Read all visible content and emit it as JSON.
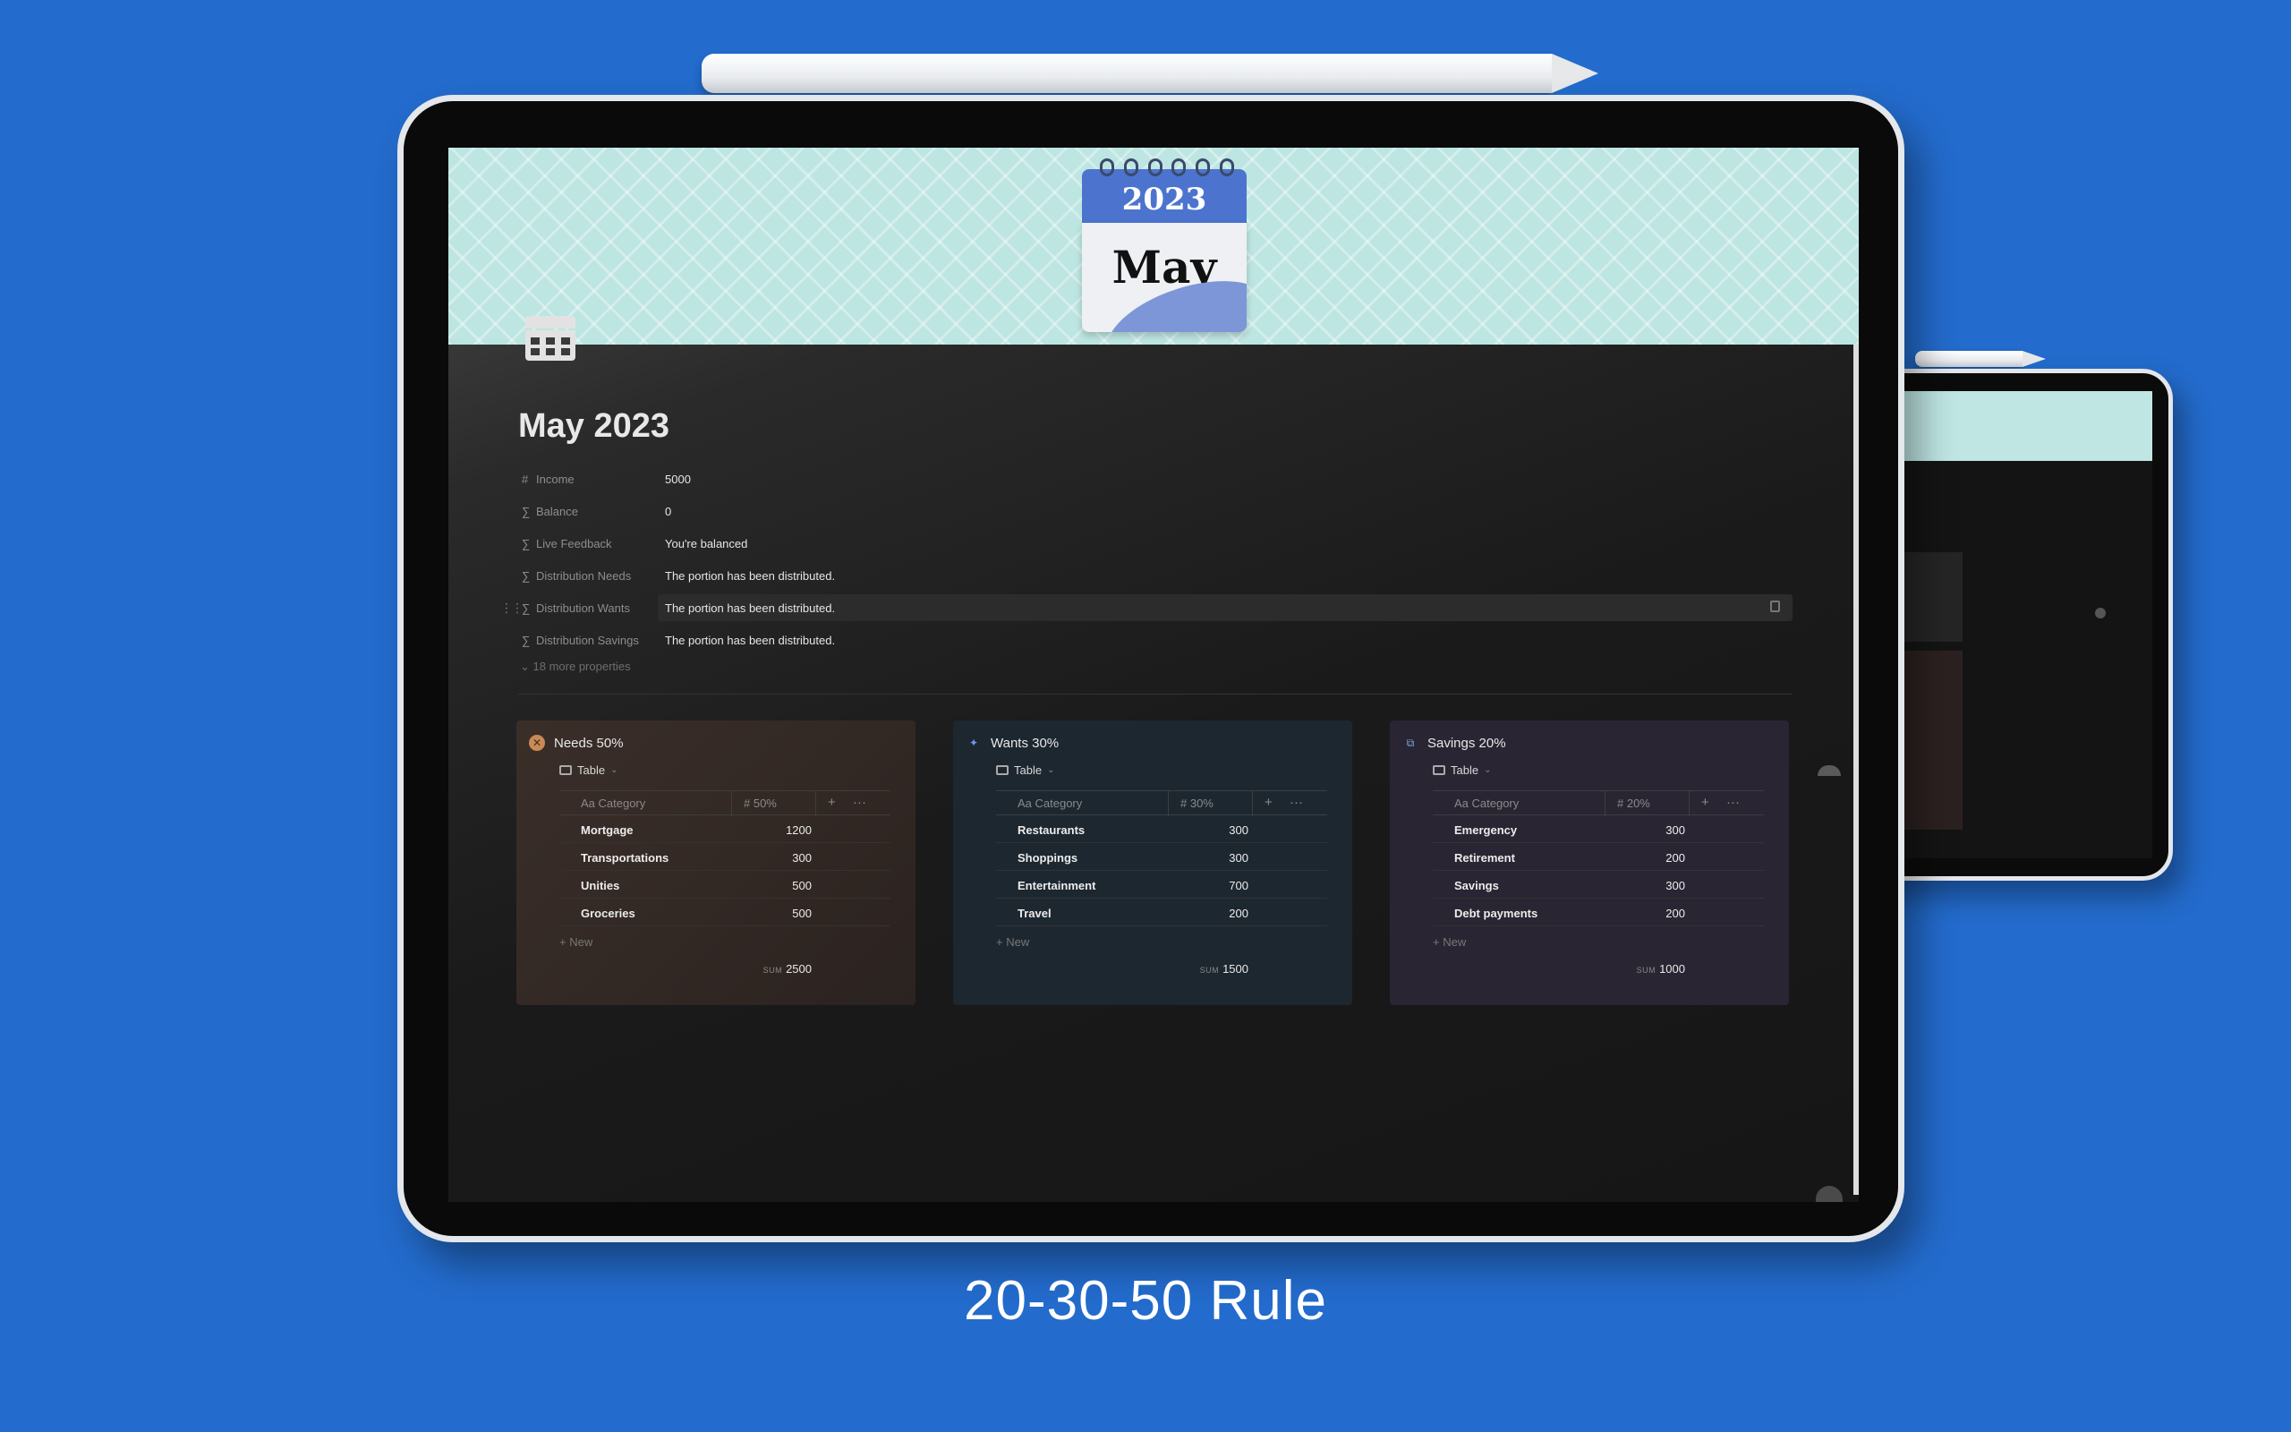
{
  "caption": "20-30-50 Rule",
  "calendar": {
    "year": "2023",
    "month": "May"
  },
  "page": {
    "title": "May 2023"
  },
  "properties": [
    {
      "icon": "#",
      "name": "Income",
      "value": "5000"
    },
    {
      "icon": "∑",
      "name": "Balance",
      "value": "0"
    },
    {
      "icon": "∑",
      "name": "Live Feedback",
      "value": "You're balanced"
    },
    {
      "icon": "∑",
      "name": "Distribution Needs",
      "value": "The portion has been distributed."
    },
    {
      "icon": "∑",
      "name": "Distribution Wants",
      "value": "The portion has been distributed."
    },
    {
      "icon": "∑",
      "name": "Distribution Savings",
      "value": "The portion has been distributed."
    }
  ],
  "more_properties": "18 more properties",
  "cards": [
    {
      "title": "Needs 50%",
      "view": "Table",
      "col_category": "Aa Category",
      "col_value": "# 50%",
      "rows": [
        {
          "category": "Mortgage",
          "value": "1200"
        },
        {
          "category": "Transportations",
          "value": "300"
        },
        {
          "category": "Unities",
          "value": "500"
        },
        {
          "category": "Groceries",
          "value": "500"
        }
      ],
      "new_label": "+ New",
      "sum_label": "SUM",
      "sum_value": "2500"
    },
    {
      "title": "Wants 30%",
      "view": "Table",
      "col_category": "Aa Category",
      "col_value": "# 30%",
      "rows": [
        {
          "category": "Restaurants",
          "value": "300"
        },
        {
          "category": "Shoppings",
          "value": "300"
        },
        {
          "category": "Entertainment",
          "value": "700"
        },
        {
          "category": "Travel",
          "value": "200"
        }
      ],
      "new_label": "+ New",
      "sum_label": "SUM",
      "sum_value": "1500"
    },
    {
      "title": "Savings 20%",
      "view": "Table",
      "col_category": "Aa Category",
      "col_value": "# 20%",
      "rows": [
        {
          "category": "Emergency",
          "value": "300"
        },
        {
          "category": "Retirement",
          "value": "200"
        },
        {
          "category": "Savings",
          "value": "300"
        },
        {
          "category": "Debt payments",
          "value": "200"
        }
      ],
      "new_label": "+ New",
      "sum_label": "SUM",
      "sum_value": "1000"
    }
  ],
  "colors": {
    "background": "#236bcc",
    "cover": "#bde5e1",
    "calendar_accent": "#4c74cf"
  }
}
